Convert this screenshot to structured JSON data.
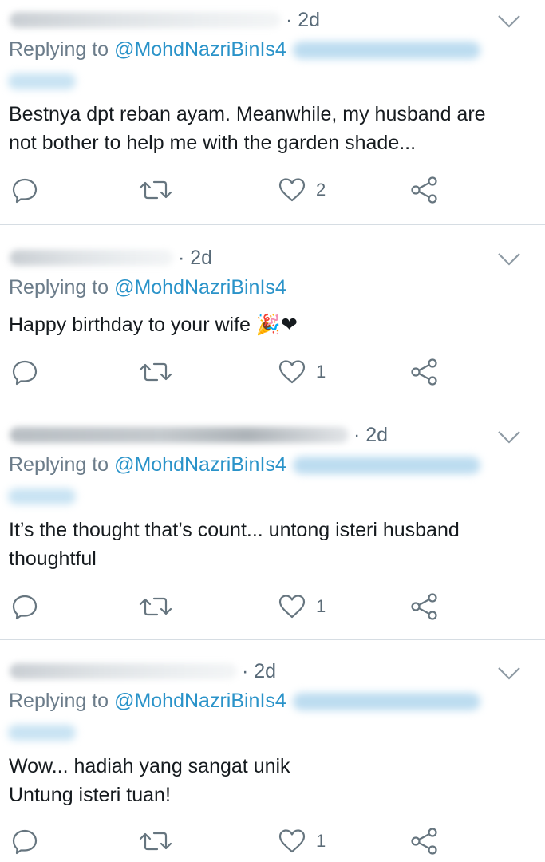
{
  "colors": {
    "link": "#2a93c9",
    "icon": "#66757f",
    "text": "#161b1f",
    "muted": "#6b7c8a",
    "divider": "#d6dde3"
  },
  "tweets": [
    {
      "time": "· 2d",
      "replying_prefix": "Replying to",
      "handle": "@MohdNazriBinIs4",
      "text_lines": [
        "Bestnya dpt reban ayam. Meanwhile, my husband are",
        "not bother to help me with the garden shade..."
      ],
      "likes": "2"
    },
    {
      "time": "· 2d",
      "replying_prefix": "Replying to",
      "handle": "@MohdNazriBinIs4",
      "text_lines": [
        "Happy birthday to your wife 🎉❤"
      ],
      "likes": "1"
    },
    {
      "time": "· 2d",
      "replying_prefix": "Replying to",
      "handle": "@MohdNazriBinIs4",
      "text_lines": [
        "It’s the thought that’s count... untong isteri husband",
        "thoughtful"
      ],
      "likes": "1"
    },
    {
      "time": "· 2d",
      "replying_prefix": "Replying to",
      "handle": "@MohdNazriBinIs4",
      "text_lines": [
        "Wow... hadiah yang sangat unik",
        "Untung isteri tuan!"
      ],
      "likes": "1"
    }
  ],
  "icons": {
    "reply": "reply-icon",
    "retweet": "retweet-icon",
    "like": "heart-icon",
    "share": "share-icon",
    "menu": "chevron-down-icon"
  }
}
